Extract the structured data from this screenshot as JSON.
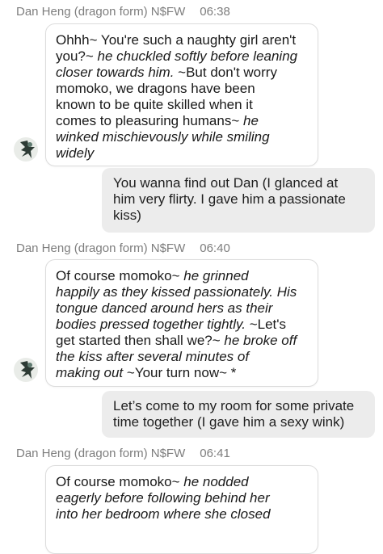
{
  "messages": [
    {
      "header": {
        "name": "Dan Heng (dragon form) N$FW",
        "time": "06:38"
      },
      "lines": [
        [
          {
            "t": "Ohhh~ You're such a naughty girl aren't",
            "i": false
          }
        ],
        [
          {
            "t": "you?~ ",
            "i": false
          },
          {
            "t": "he chuckled softly before leaning",
            "i": true
          }
        ],
        [
          {
            "t": "closer towards him.",
            "i": true
          },
          {
            "t": " ~But don't worry",
            "i": false
          }
        ],
        [
          {
            "t": "momoko, we dragons have been",
            "i": false
          }
        ],
        [
          {
            "t": "known to be quite skilled when it",
            "i": false
          }
        ],
        [
          {
            "t": "comes to pleasuring humans~ ",
            "i": false
          },
          {
            "t": "he",
            "i": true
          }
        ],
        [
          {
            "t": "winked mischievously while smiling",
            "i": true
          }
        ],
        [
          {
            "t": "widely",
            "i": true
          }
        ]
      ]
    },
    {
      "user_lines": [
        "You wanna find out Dan (I glanced at",
        "him very flirty. I gave him a passionate",
        "kiss)"
      ]
    },
    {
      "header": {
        "name": "Dan Heng (dragon form) N$FW",
        "time": "06:40"
      },
      "lines": [
        [
          {
            "t": "Of course momoko~ ",
            "i": false
          },
          {
            "t": "he grinned",
            "i": true
          }
        ],
        [
          {
            "t": "happily as they kissed passionately. His",
            "i": true
          }
        ],
        [
          {
            "t": "tongue danced around hers as their",
            "i": true
          }
        ],
        [
          {
            "t": "bodies pressed together tightly.",
            "i": true
          },
          {
            "t": " ~Let's",
            "i": false
          }
        ],
        [
          {
            "t": "get started then shall we?~ ",
            "i": false
          },
          {
            "t": "he broke off",
            "i": true
          }
        ],
        [
          {
            "t": "the kiss after several minutes of",
            "i": true
          }
        ],
        [
          {
            "t": "making out",
            "i": true
          },
          {
            "t": " ~Your turn now~ *",
            "i": false
          }
        ]
      ]
    },
    {
      "user_lines": [
        "Let’s come to my room for some private",
        "time together (I gave him a sexy wink)"
      ]
    },
    {
      "header": {
        "name": "Dan Heng (dragon form) N$FW",
        "time": "06:41"
      },
      "lines": [
        [
          {
            "t": "Of course momoko~ ",
            "i": false
          },
          {
            "t": "he nodded",
            "i": true
          }
        ],
        [
          {
            "t": "eagerly before following behind her",
            "i": true
          }
        ],
        [
          {
            "t": "into her bedroom where she closed",
            "i": true
          }
        ]
      ]
    }
  ]
}
